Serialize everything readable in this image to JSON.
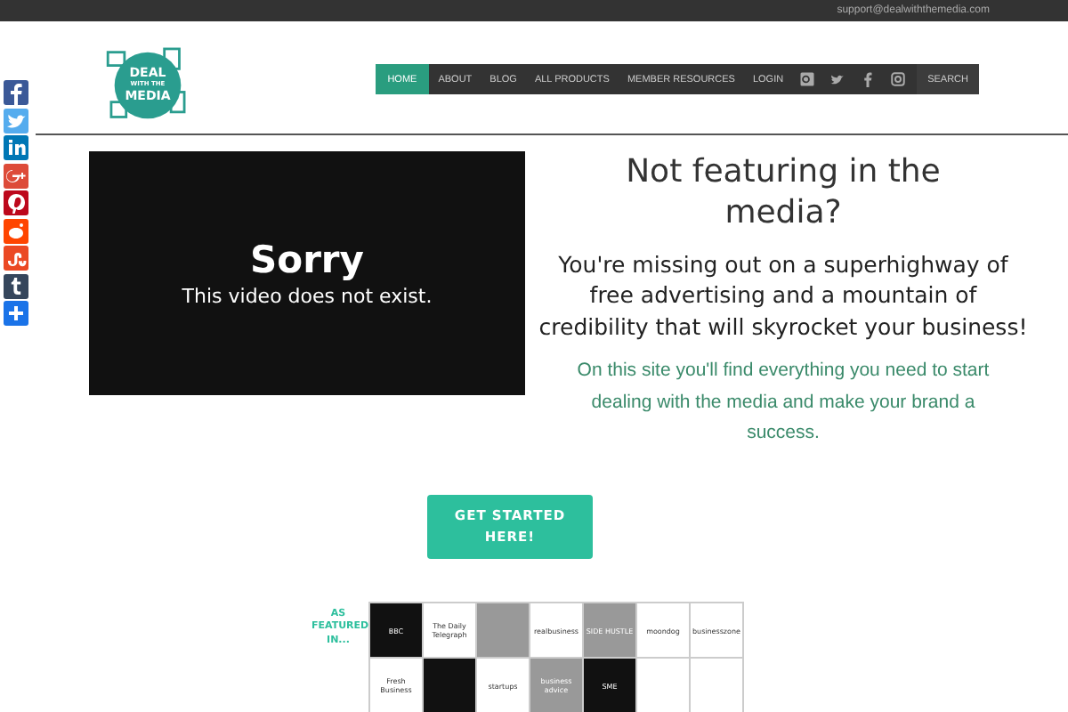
{
  "top_bar": {
    "email": "support@dealwiththemedia.com"
  },
  "logo": {
    "lines": [
      "DEAL",
      "WITH THE",
      "MEDIA"
    ]
  },
  "nav": {
    "items": [
      {
        "label": "HOME",
        "selected": true
      },
      {
        "label": "ABOUT",
        "selected": false
      },
      {
        "label": "BLOG",
        "selected": false
      },
      {
        "label": "ALL PRODUCTS",
        "selected": false
      },
      {
        "label": "MEMBER RESOURCES",
        "selected": false
      },
      {
        "label": "LOGIN",
        "selected": false
      }
    ],
    "social": [
      {
        "kind": "googleplus"
      },
      {
        "kind": "twitter"
      },
      {
        "kind": "facebook"
      },
      {
        "kind": "instagram"
      }
    ],
    "search": "SEARCH"
  },
  "share_bar": [
    {
      "kind": "facebook",
      "color": "#3b5998"
    },
    {
      "kind": "twitter",
      "color": "#55acee"
    },
    {
      "kind": "linkedin",
      "color": "#0077b5"
    },
    {
      "kind": "googleplus",
      "color": "#dd4b39"
    },
    {
      "kind": "pinterest",
      "color": "#bd081c"
    },
    {
      "kind": "reddit",
      "color": "#ff4500"
    },
    {
      "kind": "stumbleupon",
      "color": "#eb4924"
    },
    {
      "kind": "tumblr",
      "color": "#35465c"
    },
    {
      "kind": "addthis",
      "color": "#1a73e8"
    }
  ],
  "video": {
    "title": "Sorry",
    "message": "This video does not exist."
  },
  "hero": {
    "heading": "Not featuring in the media?",
    "subheading": "You're missing out on a superhighway of free advertising and a mountain of credibility that will skyrocket your business!",
    "text": "On this site you'll find everything you need to start dealing with the media and make your brand a success."
  },
  "cta": "GET STARTED HERE!",
  "featured": {
    "label": "AS FEATURED IN...",
    "logos": [
      {
        "kind": "dark",
        "text": "BBC"
      },
      {
        "kind": "light",
        "text": "The Daily Telegraph"
      },
      {
        "kind": "grey"
      },
      {
        "kind": "light",
        "text": "realbusiness"
      },
      {
        "kind": "grey",
        "text": "SIDE HUSTLE"
      },
      {
        "kind": "light",
        "text": "moondog"
      },
      {
        "kind": "light",
        "text": "businesszone"
      },
      {
        "kind": "light",
        "text": "Fresh Business"
      },
      {
        "kind": "dark"
      },
      {
        "kind": "light",
        "text": "startups"
      },
      {
        "kind": "grey",
        "text": "business advice"
      },
      {
        "kind": "dark",
        "text": "SME"
      },
      {
        "kind": "light"
      },
      {
        "kind": "light"
      }
    ]
  }
}
